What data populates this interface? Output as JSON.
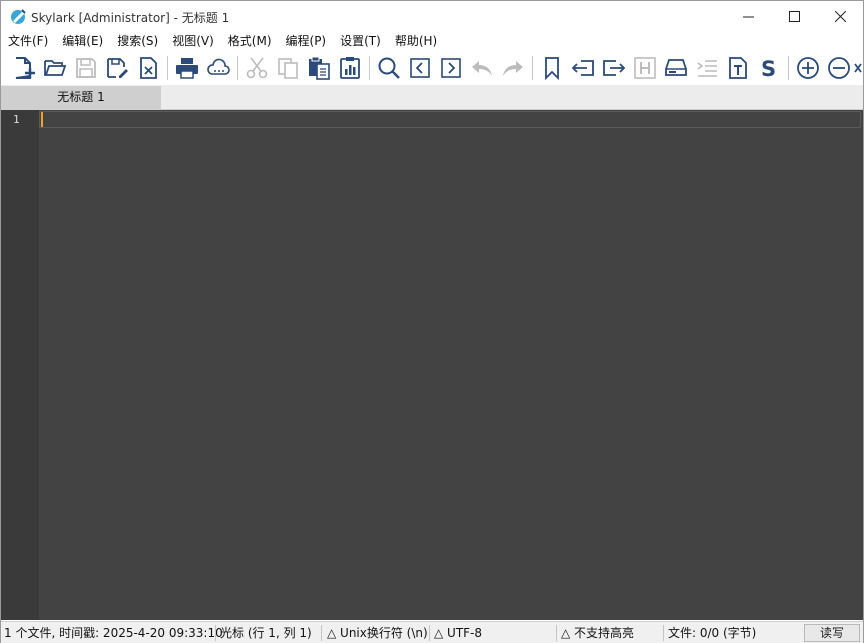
{
  "window": {
    "title": "Skylark [Administrator] - 无标题 1"
  },
  "menu": [
    "文件(F)",
    "编辑(E)",
    "搜索(S)",
    "视图(V)",
    "格式(M)",
    "编程(P)",
    "设置(T)",
    "帮助(H)"
  ],
  "toolbar": {
    "icons": [
      "new-file-icon",
      "open-folder-icon",
      "save-icon",
      "save-as-icon",
      "close-file-icon",
      "print-icon",
      "cloud-icon",
      "cut-icon",
      "copy-icon",
      "paste-icon",
      "clipboard-icon",
      "search-icon",
      "prev-icon",
      "next-icon",
      "undo-icon",
      "redo-icon",
      "bookmark-icon",
      "indent-left-icon",
      "indent-right-icon",
      "header-icon",
      "drive-icon",
      "list-indent-icon",
      "text-doc-icon",
      "script-s-icon",
      "zoom-in-icon",
      "zoom-out-icon"
    ],
    "accent": "#2a4a7a",
    "disabled": "#bcbcbc"
  },
  "tabs": [
    {
      "label": "无标题 1"
    }
  ],
  "editor": {
    "line_numbers": [
      "1"
    ],
    "bg": "#434343",
    "gutter_bg": "#3a3a3a",
    "caret_color": "#f0a030"
  },
  "status": {
    "files": "1 个文件, 时间戳: 2025-4-20 09:33:10",
    "cursor": "光标 (行 1, 列 1)",
    "eol": "△ Unix换行符 (\\n)",
    "encoding": "△ UTF-8",
    "highlight": "△ 不支持高亮",
    "size": "文件: 0/0 (字节)",
    "mode": "读写"
  }
}
